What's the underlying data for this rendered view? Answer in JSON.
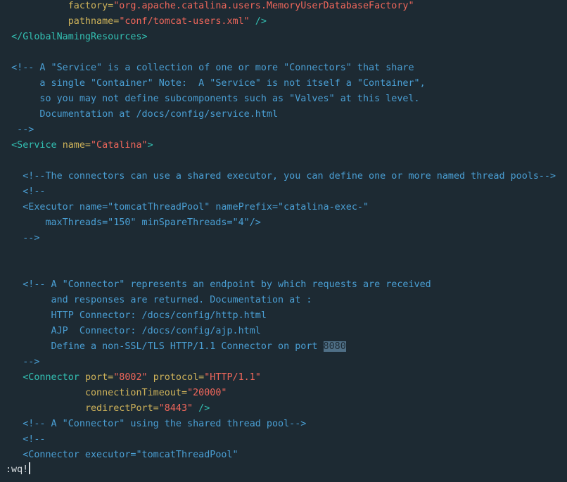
{
  "editor": {
    "lines": [
      [
        {
          "t": "            ",
          "c": "plain"
        },
        {
          "t": "factory=",
          "c": "attr"
        },
        {
          "t": "\"org.apache.catalina.users.MemoryUserDatabaseFactory\"",
          "c": "value"
        }
      ],
      [
        {
          "t": "            ",
          "c": "plain"
        },
        {
          "t": "pathname=",
          "c": "attr"
        },
        {
          "t": "\"conf/tomcat-users.xml\"",
          "c": "value"
        },
        {
          "t": " />",
          "c": "tag"
        }
      ],
      [
        {
          "t": "  ",
          "c": "plain"
        },
        {
          "t": "</GlobalNamingResources>",
          "c": "tag"
        }
      ],
      [],
      [
        {
          "t": "  <!-- A \"Service\" is a collection of one or more \"Connectors\" that share",
          "c": "comment"
        }
      ],
      [
        {
          "t": "       a single \"Container\" Note:  A \"Service\" is not itself a \"Container\",",
          "c": "comment"
        }
      ],
      [
        {
          "t": "       so you may not define subcomponents such as \"Valves\" at this level.",
          "c": "comment"
        }
      ],
      [
        {
          "t": "       Documentation at /docs/config/service.html",
          "c": "comment"
        }
      ],
      [
        {
          "t": "   -->",
          "c": "comment"
        }
      ],
      [
        {
          "t": "  ",
          "c": "plain"
        },
        {
          "t": "<Service ",
          "c": "tag"
        },
        {
          "t": "name=",
          "c": "attr"
        },
        {
          "t": "\"Catalina\"",
          "c": "value"
        },
        {
          "t": ">",
          "c": "tag"
        }
      ],
      [],
      [
        {
          "t": "    <!--The connectors can use a shared executor, you can define one or more named thread pools-->",
          "c": "comment"
        }
      ],
      [
        {
          "t": "    <!--",
          "c": "comment"
        }
      ],
      [
        {
          "t": "    <Executor name=\"tomcatThreadPool\" namePrefix=\"catalina-exec-\"",
          "c": "comment"
        }
      ],
      [
        {
          "t": "        maxThreads=\"150\" minSpareThreads=\"4\"/>",
          "c": "comment"
        }
      ],
      [
        {
          "t": "    -->",
          "c": "comment"
        }
      ],
      [],
      [],
      [
        {
          "t": "    <!-- A \"Connector\" represents an endpoint by which requests are received",
          "c": "comment"
        }
      ],
      [
        {
          "t": "         and responses are returned. Documentation at :",
          "c": "comment"
        }
      ],
      [
        {
          "t": "         HTTP Connector: /docs/config/http.html",
          "c": "comment"
        }
      ],
      [
        {
          "t": "         AJP  Connector: /docs/config/ajp.html",
          "c": "comment"
        }
      ],
      [
        {
          "t": "         Define a non-SSL/TLS HTTP/1.1 Connector on port ",
          "c": "comment"
        },
        {
          "t": "8080",
          "c": "hl"
        }
      ],
      [
        {
          "t": "    -->",
          "c": "comment"
        }
      ],
      [
        {
          "t": "    ",
          "c": "plain"
        },
        {
          "t": "<Connector ",
          "c": "tag"
        },
        {
          "t": "port=",
          "c": "attr"
        },
        {
          "t": "\"8002\"",
          "c": "value"
        },
        {
          "t": " ",
          "c": "plain"
        },
        {
          "t": "protocol=",
          "c": "attr"
        },
        {
          "t": "\"HTTP/1.1\"",
          "c": "value"
        }
      ],
      [
        {
          "t": "               ",
          "c": "plain"
        },
        {
          "t": "connectionTimeout=",
          "c": "attr"
        },
        {
          "t": "\"20000\"",
          "c": "value"
        }
      ],
      [
        {
          "t": "               ",
          "c": "plain"
        },
        {
          "t": "redirectPort=",
          "c": "attr"
        },
        {
          "t": "\"8443\"",
          "c": "value"
        },
        {
          "t": " />",
          "c": "tag"
        }
      ],
      [
        {
          "t": "    <!-- A \"Connector\" using the shared thread pool-->",
          "c": "comment"
        }
      ],
      [
        {
          "t": "    <!--",
          "c": "comment"
        }
      ],
      [
        {
          "t": "    <Connector executor=\"tomcatThreadPool\"",
          "c": "comment"
        }
      ]
    ],
    "command_line": ":wq!"
  }
}
